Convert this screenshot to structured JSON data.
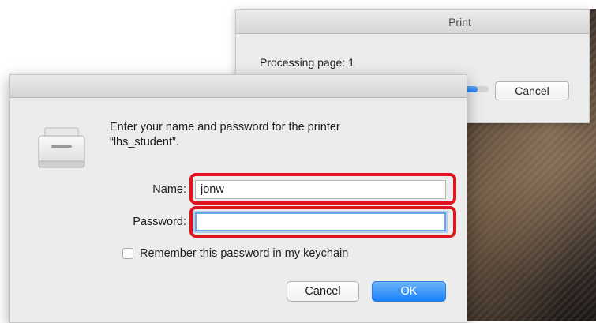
{
  "print_window": {
    "title": "Print",
    "status": "Processing page: 1",
    "progress": 0.95,
    "cancel_label": "Cancel"
  },
  "auth_dialog": {
    "message_line1": "Enter your name and password for the printer",
    "message_line2": "“lhs_student”.",
    "name_label": "Name:",
    "name_value": "jonw",
    "password_label": "Password:",
    "password_value": "",
    "remember_label": "Remember this password in my keychain",
    "remember_checked": false,
    "cancel_label": "Cancel",
    "ok_label": "OK",
    "icon": "printer-icon"
  },
  "colors": {
    "highlight": "#e0141e",
    "primary_button": "#1a82fb",
    "focus_ring": "#6aa6f0"
  }
}
